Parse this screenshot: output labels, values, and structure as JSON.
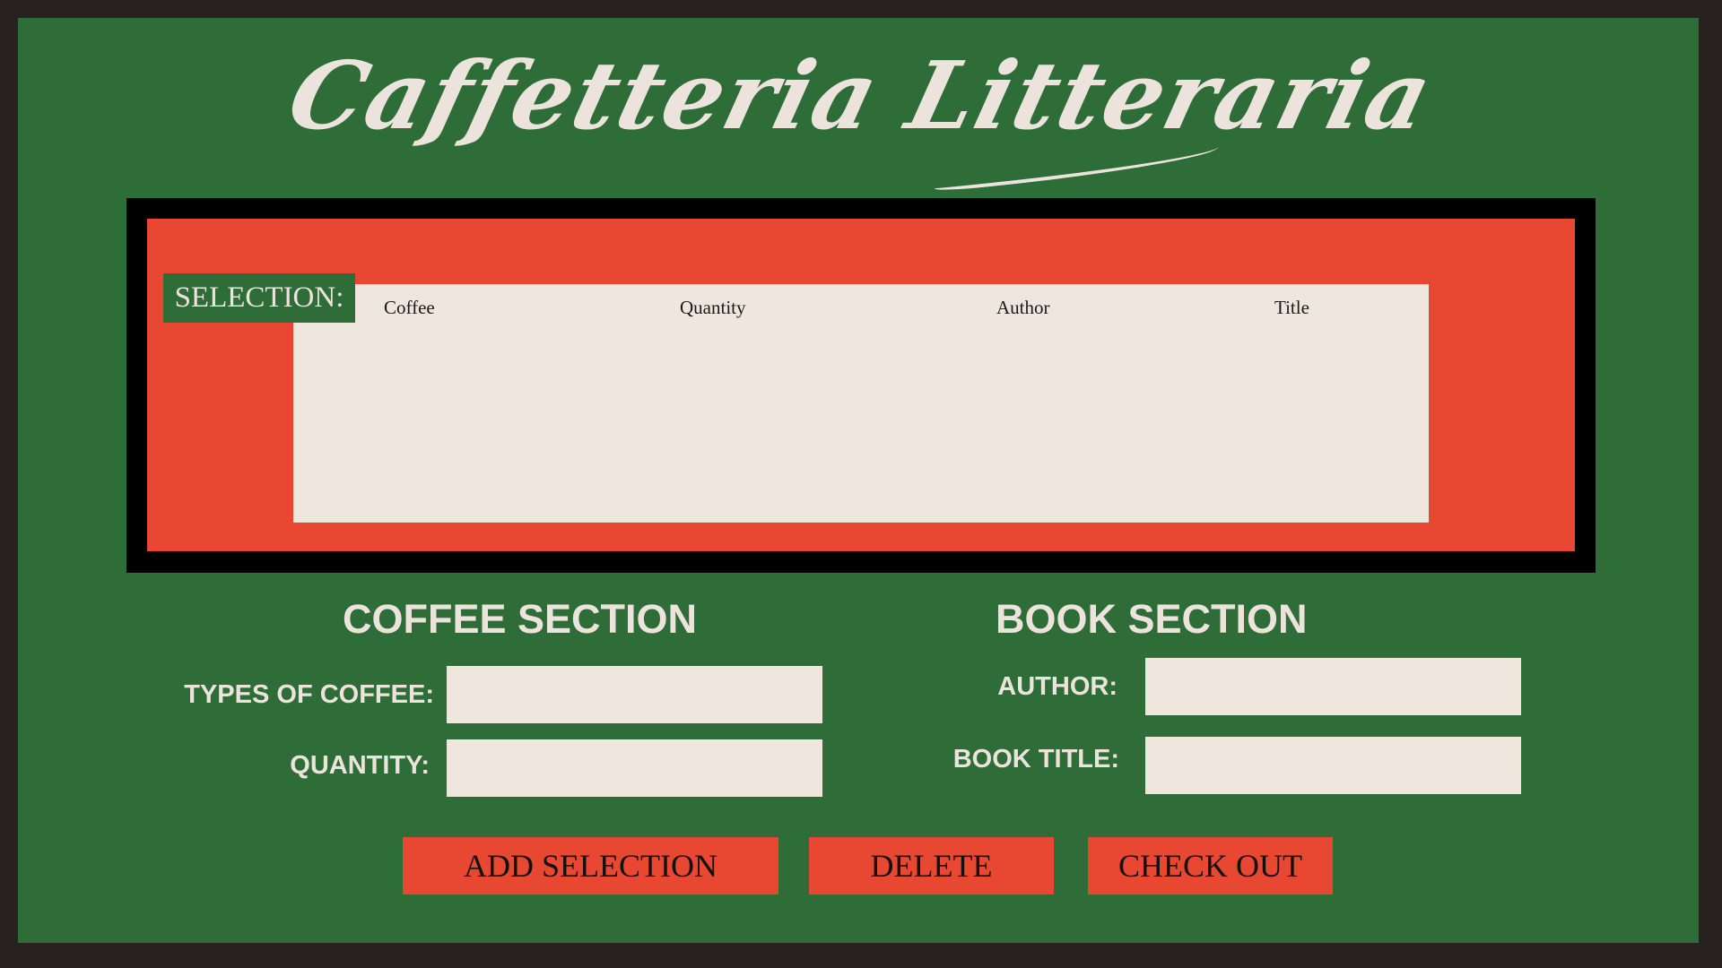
{
  "app": {
    "title": "Caffetteria Litteraria"
  },
  "selection": {
    "label": "SELECTION:",
    "columns": [
      "Coffee",
      "Quantity",
      "Author",
      "Title"
    ]
  },
  "coffee_section": {
    "heading": "COFFEE SECTION",
    "type_label": "TYPES OF COFFEE:",
    "type_value": "",
    "quantity_label": "QUANTITY:",
    "quantity_value": ""
  },
  "book_section": {
    "heading": "BOOK SECTION",
    "author_label": "AUTHOR:",
    "author_value": "",
    "title_label": "BOOK TITLE:",
    "title_value": ""
  },
  "buttons": {
    "add": "ADD SELECTION",
    "delete": "DELETE",
    "checkout": "CHECK OUT"
  },
  "colors": {
    "background_green": "#2f6d38",
    "accent_red": "#e84731",
    "cream": "#efe6dd",
    "border_dark": "#27221f"
  }
}
